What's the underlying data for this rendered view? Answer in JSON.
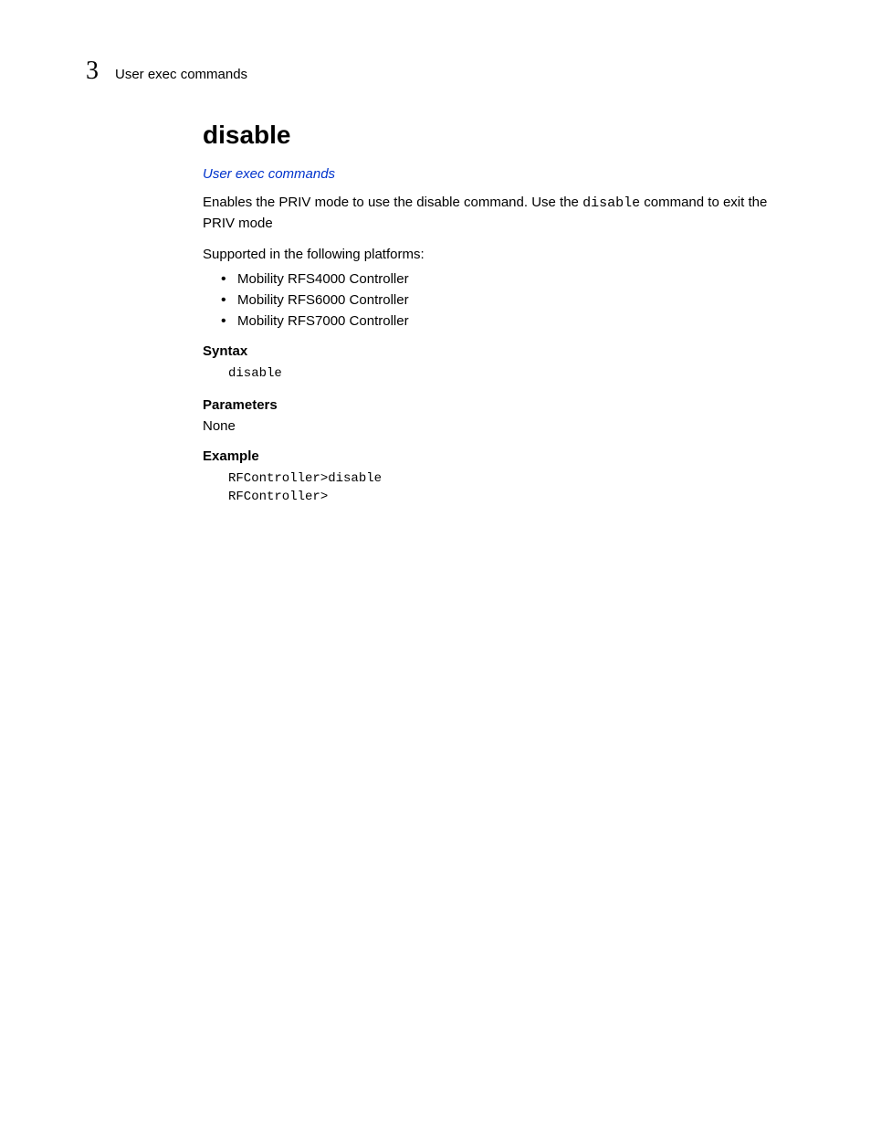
{
  "header": {
    "chapter_number": "3",
    "section_name": "User exec commands"
  },
  "content": {
    "title": "disable",
    "link_text": "User exec commands",
    "description_pre": "Enables the PRIV mode to use the disable command. Use the ",
    "description_code": "disable",
    "description_post": " command to exit the PRIV mode",
    "supported_label": "Supported in the following platforms:",
    "platforms": [
      "Mobility RFS4000 Controller",
      "Mobility RFS6000 Controller",
      "Mobility RFS7000 Controller"
    ],
    "syntax": {
      "heading": "Syntax",
      "code": "disable"
    },
    "parameters": {
      "heading": "Parameters",
      "value": "None"
    },
    "example": {
      "heading": "Example",
      "code": "RFController>disable\nRFController>"
    }
  }
}
